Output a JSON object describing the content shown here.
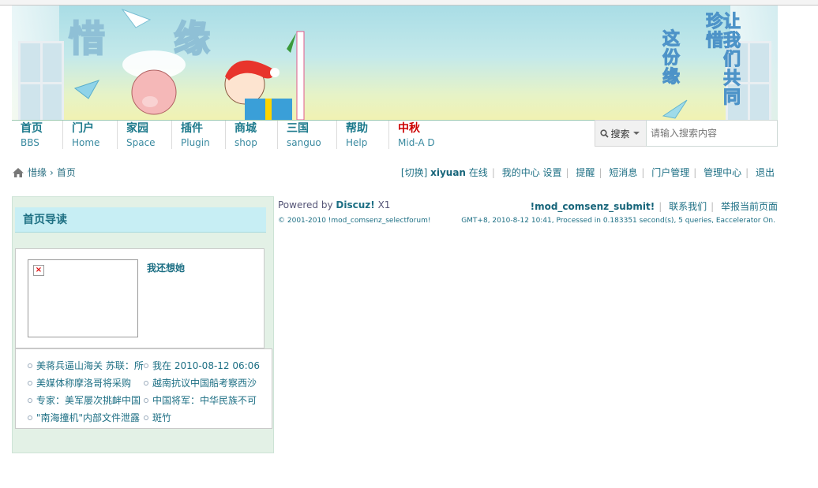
{
  "banner": {
    "title_chars": [
      "惜",
      "缘"
    ],
    "slogan_right": "让我们共同珍惜",
    "slogan_left": "这份缘"
  },
  "nav": [
    {
      "cn": "首页",
      "en": "BBS"
    },
    {
      "cn": "门户",
      "en": "Home"
    },
    {
      "cn": "家园",
      "en": "Space"
    },
    {
      "cn": "插件",
      "en": "Plugin"
    },
    {
      "cn": "商城",
      "en": "shop"
    },
    {
      "cn": "三国",
      "en": "sanguo"
    },
    {
      "cn": "帮助",
      "en": "Help"
    },
    {
      "cn": "中秋",
      "en": "Mid-A D"
    }
  ],
  "search": {
    "button": "搜索",
    "placeholder": "请输入搜索内容"
  },
  "breadcrumb": {
    "site": "惜缘",
    "sep": "›",
    "current": "首页"
  },
  "userbar": {
    "switch": "[切换]",
    "username": "xiyuan",
    "status": "在线",
    "links": [
      "我的中心",
      "设置",
      "提醒",
      "短消息",
      "门户管理",
      "管理中心",
      "退出"
    ]
  },
  "panel": {
    "title": "首页导读",
    "featured_title": "我还想她",
    "items": [
      "美蒋兵逼山海关 苏联：所",
      "我在 2010-08-12 06:06",
      "美媒体称摩洛哥将采购",
      "越南抗议中国船考察西沙",
      "专家：美军屡次挑衅中国",
      "中国将军：中华民族不可",
      "\"南海撞机\"内部文件泄露",
      "斑竹"
    ]
  },
  "footer": {
    "powered_prefix": "Powered by",
    "powered_brand": "Discuz!",
    "version": "X1",
    "copyright": "© 2001-2010 !mod_comsenz_selectforum!",
    "submit": "!mod_comsenz_submit!",
    "contact": "联系我们",
    "report": "举报当前页面",
    "stats": "GMT+8, 2010-8-12 10:41, Processed in 0.183351 second(s), 5 queries, Eaccelerator On."
  }
}
